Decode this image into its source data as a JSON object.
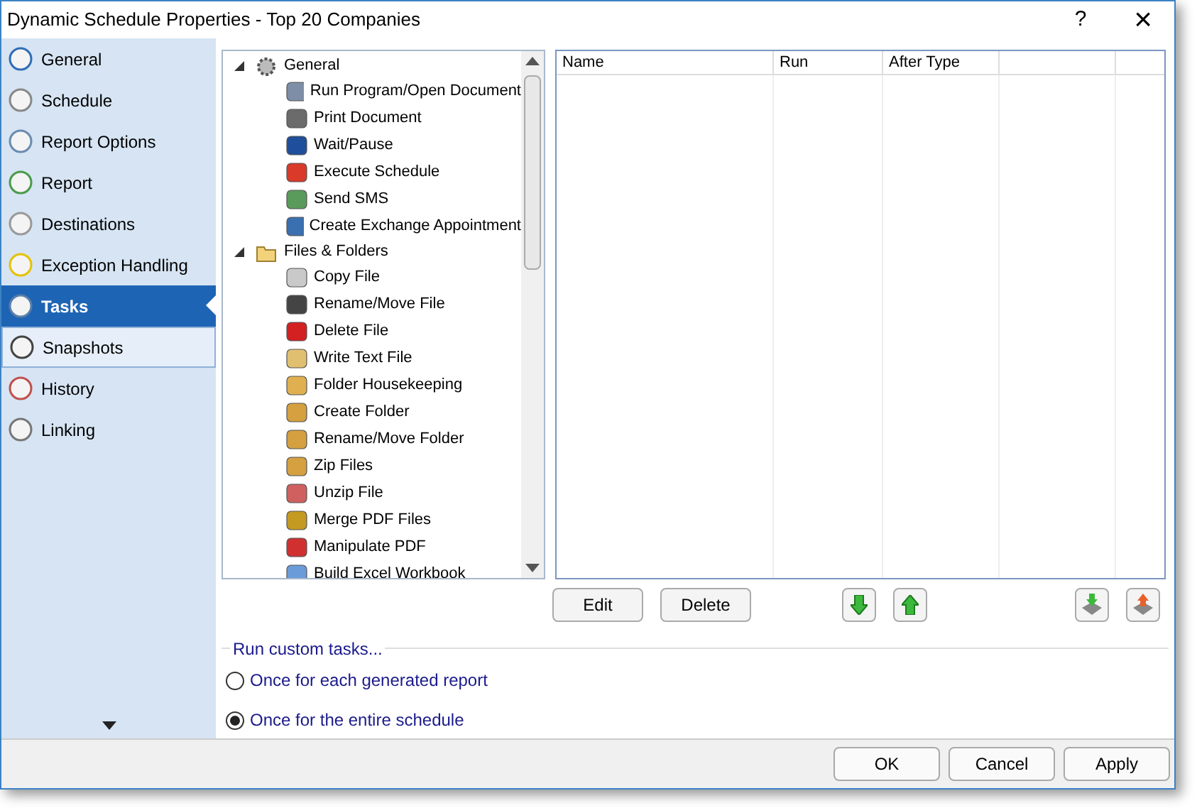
{
  "window": {
    "title": "Dynamic Schedule Properties - Top 20 Companies",
    "help": "?",
    "close": "×"
  },
  "sidebar": {
    "items": [
      {
        "label": "General",
        "selected": false,
        "hovered": false
      },
      {
        "label": "Schedule",
        "selected": false,
        "hovered": false
      },
      {
        "label": "Report Options",
        "selected": false,
        "hovered": false
      },
      {
        "label": "Report",
        "selected": false,
        "hovered": false
      },
      {
        "label": "Destinations",
        "selected": false,
        "hovered": false
      },
      {
        "label": "Exception Handling",
        "selected": false,
        "hovered": false
      },
      {
        "label": "Tasks",
        "selected": true,
        "hovered": false
      },
      {
        "label": "Snapshots",
        "selected": false,
        "hovered": true
      },
      {
        "label": "History",
        "selected": false,
        "hovered": false
      },
      {
        "label": "Linking",
        "selected": false,
        "hovered": false
      }
    ]
  },
  "task_tree": [
    {
      "label": "General",
      "expanded": true,
      "children": [
        {
          "label": "Run Program/Open Document"
        },
        {
          "label": "Print Document"
        },
        {
          "label": "Wait/Pause"
        },
        {
          "label": "Execute Schedule"
        },
        {
          "label": "Send SMS"
        },
        {
          "label": "Create Exchange Appointment"
        }
      ]
    },
    {
      "label": "Files & Folders",
      "expanded": true,
      "children": [
        {
          "label": "Copy File"
        },
        {
          "label": "Rename/Move File"
        },
        {
          "label": "Delete File"
        },
        {
          "label": "Write Text File"
        },
        {
          "label": "Folder Housekeeping"
        },
        {
          "label": "Create Folder"
        },
        {
          "label": "Rename/Move Folder"
        },
        {
          "label": "Zip Files"
        },
        {
          "label": "Unzip File"
        },
        {
          "label": "Merge PDF Files"
        },
        {
          "label": "Manipulate PDF"
        },
        {
          "label": "Build Excel Workbook"
        }
      ]
    }
  ],
  "task_table": {
    "columns": [
      "Name",
      "Run",
      "After Type"
    ]
  },
  "task_buttons": [
    "Edit",
    "Delete"
  ],
  "run_custom_tasks": {
    "legend": "Run custom tasks...",
    "options": [
      {
        "label": "Once for each generated report",
        "selected": false
      },
      {
        "label": "Once for the entire schedule",
        "selected": true
      }
    ]
  },
  "footer_buttons": [
    "OK",
    "Cancel",
    "Apply"
  ]
}
